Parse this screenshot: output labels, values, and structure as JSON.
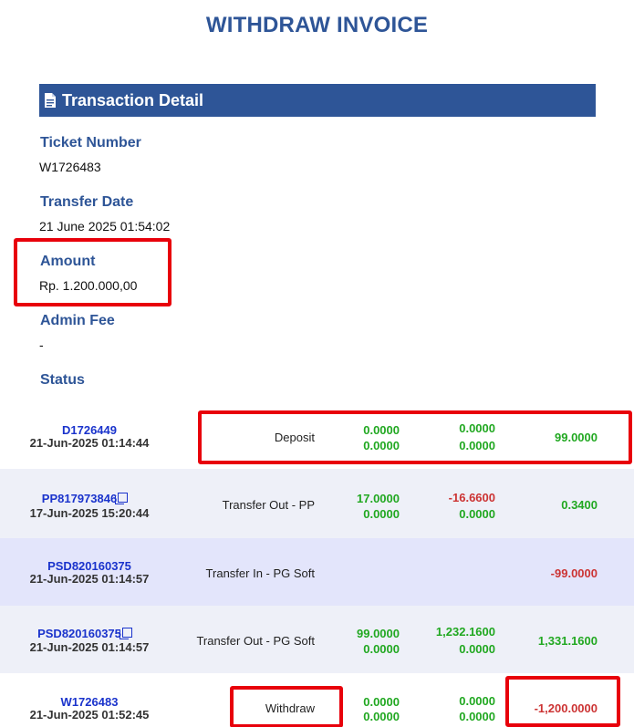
{
  "page": {
    "title": "WITHDRAW INVOICE"
  },
  "section": {
    "title": "Transaction Detail",
    "icon": "document-icon"
  },
  "fields": {
    "ticket_number": {
      "label": "Ticket Number",
      "value": "W1726483"
    },
    "transfer_date": {
      "label": "Transfer Date",
      "value": "21 June 2025 01:54:02"
    },
    "amount": {
      "label": "Amount",
      "value": "Rp. 1.200.000,00"
    },
    "admin_fee": {
      "label": "Admin Fee",
      "value": "-"
    },
    "status": {
      "label": "Status"
    }
  },
  "colors": {
    "brand_blue": "#2e5597",
    "link_blue": "#1a33cc",
    "positive_green": "#21a821",
    "negative_red": "#cc3333",
    "highlight_red": "#e8000b",
    "row_alt_bg": "#eef0f8",
    "row_highlight_bg": "#e3e5fb"
  },
  "transactions": [
    {
      "ref": "D1726449",
      "date": "21-Jun-2025 01:14:44",
      "type": "Deposit",
      "col1_top": "0.0000",
      "col1_bottom": "0.0000",
      "col2_top": "0.0000",
      "col2_bottom": "0.0000",
      "balance": "99.0000"
    },
    {
      "ref": "PP817973846",
      "date": "17-Jun-2025 15:20:44",
      "type": "Transfer Out - PP",
      "col1_top": "17.0000",
      "col1_bottom": "0.0000",
      "col2_top": "-16.6600",
      "col2_bottom": "0.0000",
      "balance": "0.3400"
    },
    {
      "ref": "PSD820160375",
      "date": "21-Jun-2025 01:14:57",
      "type": "Transfer In - PG Soft",
      "balance": "-99.0000"
    },
    {
      "ref": "PSD820160375",
      "date": "21-Jun-2025 01:14:57",
      "type": "Transfer Out - PG Soft",
      "col1_top": "99.0000",
      "col1_bottom": "0.0000",
      "col2_top": "1,232.1600",
      "col2_bottom": "0.0000",
      "balance": "1,331.1600"
    },
    {
      "ref": "W1726483",
      "date": "21-Jun-2025 01:52:45",
      "type": "Withdraw",
      "col1_top": "0.0000",
      "col1_bottom": "0.0000",
      "col2_top": "0.0000",
      "col2_bottom": "0.0000",
      "balance": "-1,200.0000"
    }
  ]
}
